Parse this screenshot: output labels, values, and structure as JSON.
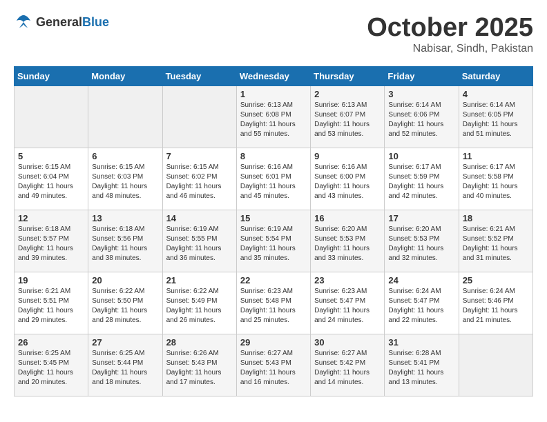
{
  "header": {
    "logo_general": "General",
    "logo_blue": "Blue",
    "month": "October 2025",
    "location": "Nabisar, Sindh, Pakistan"
  },
  "weekdays": [
    "Sunday",
    "Monday",
    "Tuesday",
    "Wednesday",
    "Thursday",
    "Friday",
    "Saturday"
  ],
  "weeks": [
    [
      {
        "day": "",
        "info": ""
      },
      {
        "day": "",
        "info": ""
      },
      {
        "day": "",
        "info": ""
      },
      {
        "day": "1",
        "info": "Sunrise: 6:13 AM\nSunset: 6:08 PM\nDaylight: 11 hours\nand 55 minutes."
      },
      {
        "day": "2",
        "info": "Sunrise: 6:13 AM\nSunset: 6:07 PM\nDaylight: 11 hours\nand 53 minutes."
      },
      {
        "day": "3",
        "info": "Sunrise: 6:14 AM\nSunset: 6:06 PM\nDaylight: 11 hours\nand 52 minutes."
      },
      {
        "day": "4",
        "info": "Sunrise: 6:14 AM\nSunset: 6:05 PM\nDaylight: 11 hours\nand 51 minutes."
      }
    ],
    [
      {
        "day": "5",
        "info": "Sunrise: 6:15 AM\nSunset: 6:04 PM\nDaylight: 11 hours\nand 49 minutes."
      },
      {
        "day": "6",
        "info": "Sunrise: 6:15 AM\nSunset: 6:03 PM\nDaylight: 11 hours\nand 48 minutes."
      },
      {
        "day": "7",
        "info": "Sunrise: 6:15 AM\nSunset: 6:02 PM\nDaylight: 11 hours\nand 46 minutes."
      },
      {
        "day": "8",
        "info": "Sunrise: 6:16 AM\nSunset: 6:01 PM\nDaylight: 11 hours\nand 45 minutes."
      },
      {
        "day": "9",
        "info": "Sunrise: 6:16 AM\nSunset: 6:00 PM\nDaylight: 11 hours\nand 43 minutes."
      },
      {
        "day": "10",
        "info": "Sunrise: 6:17 AM\nSunset: 5:59 PM\nDaylight: 11 hours\nand 42 minutes."
      },
      {
        "day": "11",
        "info": "Sunrise: 6:17 AM\nSunset: 5:58 PM\nDaylight: 11 hours\nand 40 minutes."
      }
    ],
    [
      {
        "day": "12",
        "info": "Sunrise: 6:18 AM\nSunset: 5:57 PM\nDaylight: 11 hours\nand 39 minutes."
      },
      {
        "day": "13",
        "info": "Sunrise: 6:18 AM\nSunset: 5:56 PM\nDaylight: 11 hours\nand 38 minutes."
      },
      {
        "day": "14",
        "info": "Sunrise: 6:19 AM\nSunset: 5:55 PM\nDaylight: 11 hours\nand 36 minutes."
      },
      {
        "day": "15",
        "info": "Sunrise: 6:19 AM\nSunset: 5:54 PM\nDaylight: 11 hours\nand 35 minutes."
      },
      {
        "day": "16",
        "info": "Sunrise: 6:20 AM\nSunset: 5:53 PM\nDaylight: 11 hours\nand 33 minutes."
      },
      {
        "day": "17",
        "info": "Sunrise: 6:20 AM\nSunset: 5:53 PM\nDaylight: 11 hours\nand 32 minutes."
      },
      {
        "day": "18",
        "info": "Sunrise: 6:21 AM\nSunset: 5:52 PM\nDaylight: 11 hours\nand 31 minutes."
      }
    ],
    [
      {
        "day": "19",
        "info": "Sunrise: 6:21 AM\nSunset: 5:51 PM\nDaylight: 11 hours\nand 29 minutes."
      },
      {
        "day": "20",
        "info": "Sunrise: 6:22 AM\nSunset: 5:50 PM\nDaylight: 11 hours\nand 28 minutes."
      },
      {
        "day": "21",
        "info": "Sunrise: 6:22 AM\nSunset: 5:49 PM\nDaylight: 11 hours\nand 26 minutes."
      },
      {
        "day": "22",
        "info": "Sunrise: 6:23 AM\nSunset: 5:48 PM\nDaylight: 11 hours\nand 25 minutes."
      },
      {
        "day": "23",
        "info": "Sunrise: 6:23 AM\nSunset: 5:47 PM\nDaylight: 11 hours\nand 24 minutes."
      },
      {
        "day": "24",
        "info": "Sunrise: 6:24 AM\nSunset: 5:47 PM\nDaylight: 11 hours\nand 22 minutes."
      },
      {
        "day": "25",
        "info": "Sunrise: 6:24 AM\nSunset: 5:46 PM\nDaylight: 11 hours\nand 21 minutes."
      }
    ],
    [
      {
        "day": "26",
        "info": "Sunrise: 6:25 AM\nSunset: 5:45 PM\nDaylight: 11 hours\nand 20 minutes."
      },
      {
        "day": "27",
        "info": "Sunrise: 6:25 AM\nSunset: 5:44 PM\nDaylight: 11 hours\nand 18 minutes."
      },
      {
        "day": "28",
        "info": "Sunrise: 6:26 AM\nSunset: 5:43 PM\nDaylight: 11 hours\nand 17 minutes."
      },
      {
        "day": "29",
        "info": "Sunrise: 6:27 AM\nSunset: 5:43 PM\nDaylight: 11 hours\nand 16 minutes."
      },
      {
        "day": "30",
        "info": "Sunrise: 6:27 AM\nSunset: 5:42 PM\nDaylight: 11 hours\nand 14 minutes."
      },
      {
        "day": "31",
        "info": "Sunrise: 6:28 AM\nSunset: 5:41 PM\nDaylight: 11 hours\nand 13 minutes."
      },
      {
        "day": "",
        "info": ""
      }
    ]
  ]
}
